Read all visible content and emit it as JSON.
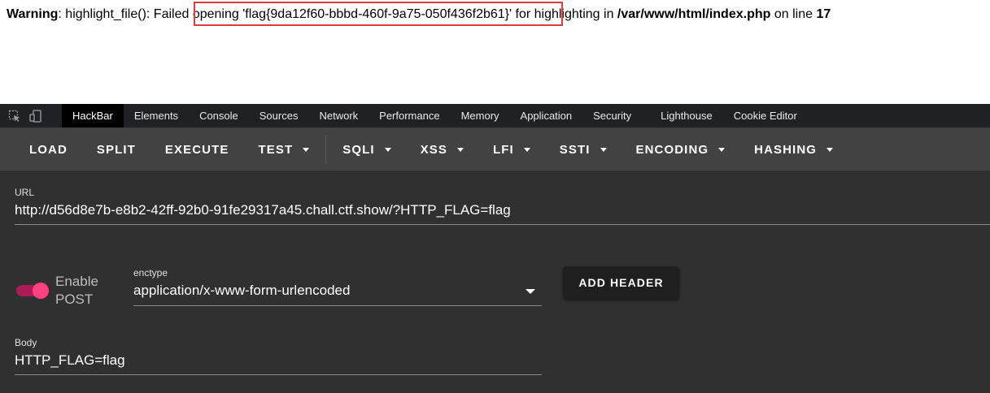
{
  "warning": {
    "label": "Warning",
    "text_before": ": highlight_file(): Failed opening '",
    "flag": "flag{9da12f60-bbbd-460f-9a75-050f436f2b61}",
    "text_after": "' for highlighting in ",
    "path": "/var/www/html/index.php",
    "line_text": " on line ",
    "line_number": "17"
  },
  "devtools": {
    "tabs": [
      "HackBar",
      "Elements",
      "Console",
      "Sources",
      "Network",
      "Performance",
      "Memory",
      "Application",
      "Security",
      "Lighthouse",
      "Cookie Editor"
    ],
    "active_tab": "HackBar"
  },
  "hackbar": {
    "toolbar": {
      "load": "LOAD",
      "split": "SPLIT",
      "execute": "EXECUTE",
      "test": "TEST",
      "sqli": "SQLI",
      "xss": "XSS",
      "lfi": "LFI",
      "ssti": "SSTI",
      "encoding": "ENCODING",
      "hashing": "HASHING"
    },
    "url_label": "URL",
    "url_value": "http://d56d8e7b-e8b2-42ff-92b0-91fe29317a45.chall.ctf.show/?HTTP_FLAG=flag",
    "enable_post_line1": "Enable",
    "enable_post_line2": "POST",
    "enctype_label": "enctype",
    "enctype_value": "application/x-www-form-urlencoded",
    "add_header": "ADD HEADER",
    "body_label": "Body",
    "body_value": "HTTP_FLAG=flag"
  },
  "colors": {
    "highlight_box": "#e03c3c",
    "toggle_accent": "#ff4081",
    "toolbar_bg": "#424242",
    "panel_bg": "#303030"
  }
}
